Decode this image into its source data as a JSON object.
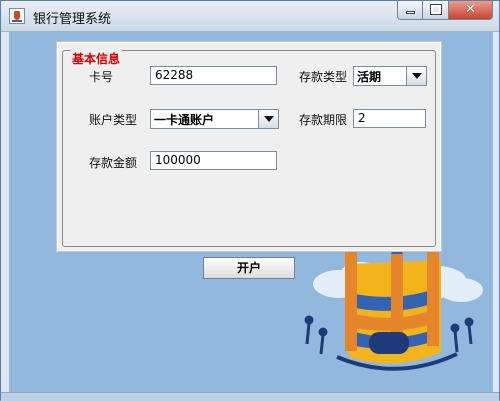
{
  "window": {
    "title": "银行管理系统"
  },
  "form": {
    "group_title": "基本信息",
    "card_number_label": "卡号",
    "card_number_value": "62288",
    "account_type_label": "账户类型",
    "account_type_value": "一卡通账户",
    "deposit_amount_label": "存款金额",
    "deposit_amount_value": "100000",
    "deposit_type_label": "存款类型",
    "deposit_type_value": "活期",
    "deposit_term_label": "存款期限",
    "deposit_term_value": "2"
  },
  "actions": {
    "open_account_label": "开户"
  },
  "colors": {
    "group_title": "#d40000",
    "content_background": "#92b9dd"
  }
}
